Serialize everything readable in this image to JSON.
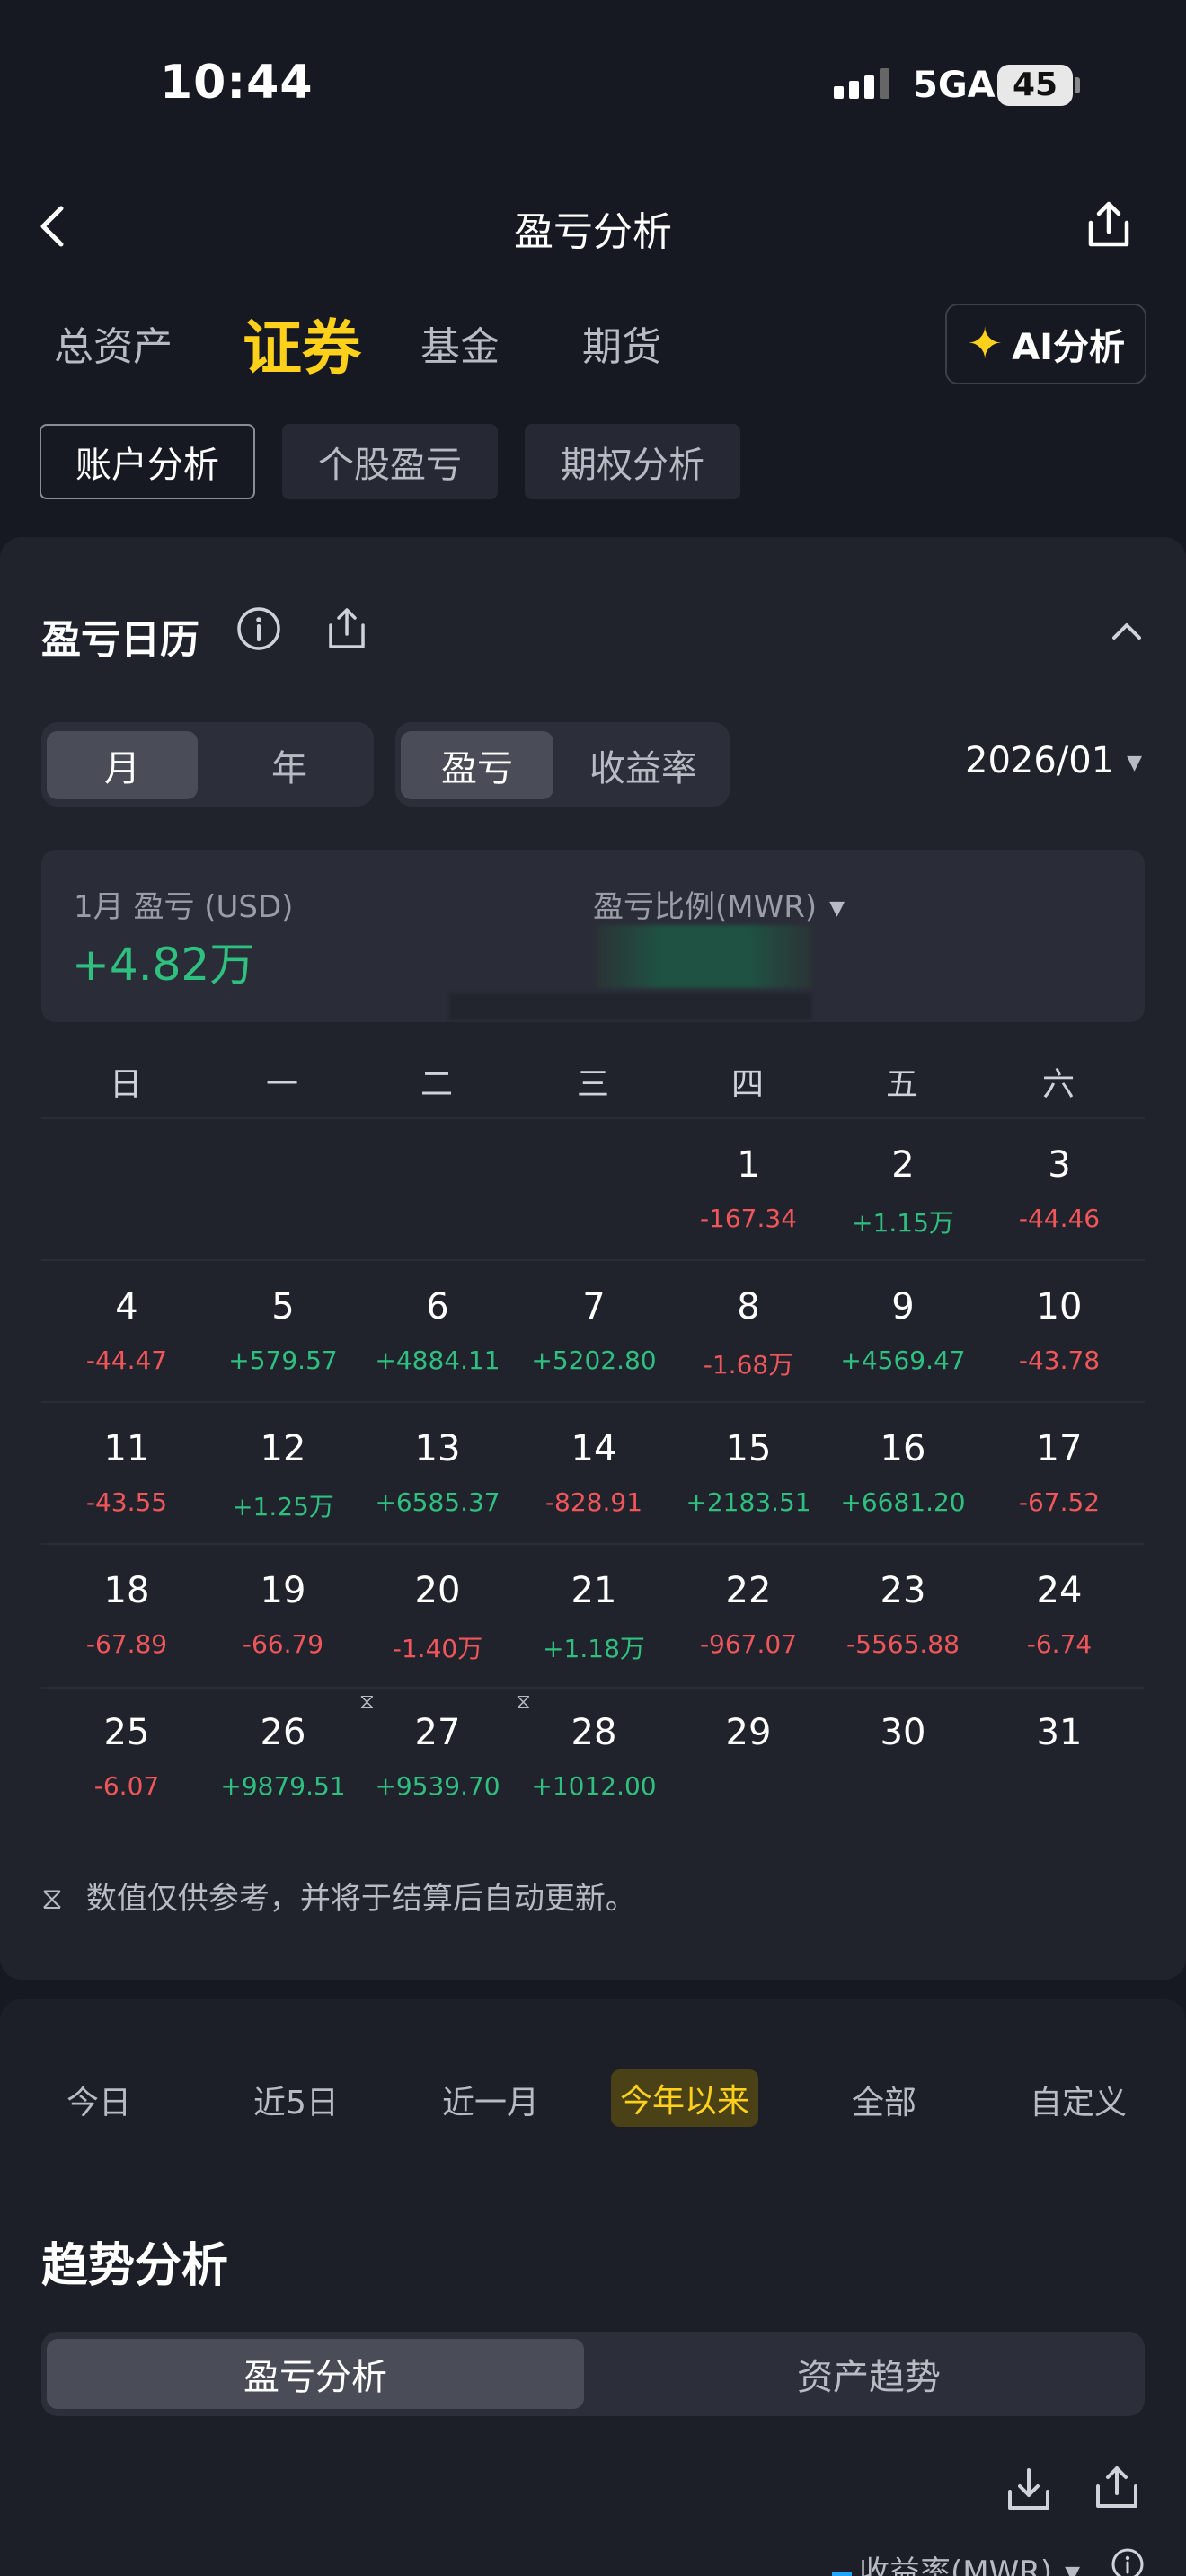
{
  "status_bar": {
    "time": "10:44",
    "network": "5GA",
    "battery": "45"
  },
  "header": {
    "title": "盈亏分析"
  },
  "top_tabs": [
    "总资产",
    "证券",
    "基金",
    "期货"
  ],
  "ai_button": "AI分析",
  "sub_tabs": [
    "账户分析",
    "个股盈亏",
    "期权分析"
  ],
  "calendar": {
    "title": "盈亏日历",
    "range_toggle": [
      "月",
      "年"
    ],
    "metric_toggle": [
      "盈亏",
      "收益率"
    ],
    "selected_month": "2026/01",
    "summary_label": "1月 盈亏 (USD)",
    "summary_value": "+4.82万",
    "ratio_label": "盈亏比例(MWR)",
    "weekdays": [
      "日",
      "一",
      "二",
      "三",
      "四",
      "五",
      "六"
    ],
    "days": [
      {
        "d": "1",
        "v": "-167.34"
      },
      {
        "d": "2",
        "v": "+1.15万"
      },
      {
        "d": "3",
        "v": "-44.46"
      },
      {
        "d": "4",
        "v": "-44.47"
      },
      {
        "d": "5",
        "v": "+579.57"
      },
      {
        "d": "6",
        "v": "+4884.11"
      },
      {
        "d": "7",
        "v": "+5202.80"
      },
      {
        "d": "8",
        "v": "-1.68万"
      },
      {
        "d": "9",
        "v": "+4569.47"
      },
      {
        "d": "10",
        "v": "-43.78"
      },
      {
        "d": "11",
        "v": "-43.55"
      },
      {
        "d": "12",
        "v": "+1.25万"
      },
      {
        "d": "13",
        "v": "+6585.37"
      },
      {
        "d": "14",
        "v": "-828.91"
      },
      {
        "d": "15",
        "v": "+2183.51"
      },
      {
        "d": "16",
        "v": "+6681.20"
      },
      {
        "d": "17",
        "v": "-67.52"
      },
      {
        "d": "18",
        "v": "-67.89"
      },
      {
        "d": "19",
        "v": "-66.79"
      },
      {
        "d": "20",
        "v": "-1.40万"
      },
      {
        "d": "21",
        "v": "+1.18万"
      },
      {
        "d": "22",
        "v": "-967.07"
      },
      {
        "d": "23",
        "v": "-5565.88"
      },
      {
        "d": "24",
        "v": "-6.74"
      },
      {
        "d": "25",
        "v": "-6.07"
      },
      {
        "d": "26",
        "v": "+9879.51"
      },
      {
        "d": "27",
        "v": "+9539.70"
      },
      {
        "d": "28",
        "v": "+1012.00"
      },
      {
        "d": "29",
        "v": ""
      },
      {
        "d": "30",
        "v": ""
      },
      {
        "d": "31",
        "v": ""
      }
    ],
    "hourglass": "⧖",
    "footnote": "数值仅供参考，并将于结算后自动更新。"
  },
  "periods": [
    "今日",
    "近5日",
    "近一月",
    "今年以来",
    "全部",
    "自定义"
  ],
  "trend": {
    "title": "趋势分析",
    "toggle": [
      "盈亏分析",
      "资产趋势"
    ],
    "legend": "收益率(MWR)"
  },
  "colors": {
    "positive": "#2fc080",
    "negative": "#f0565a",
    "accent": "#ffd11a"
  }
}
